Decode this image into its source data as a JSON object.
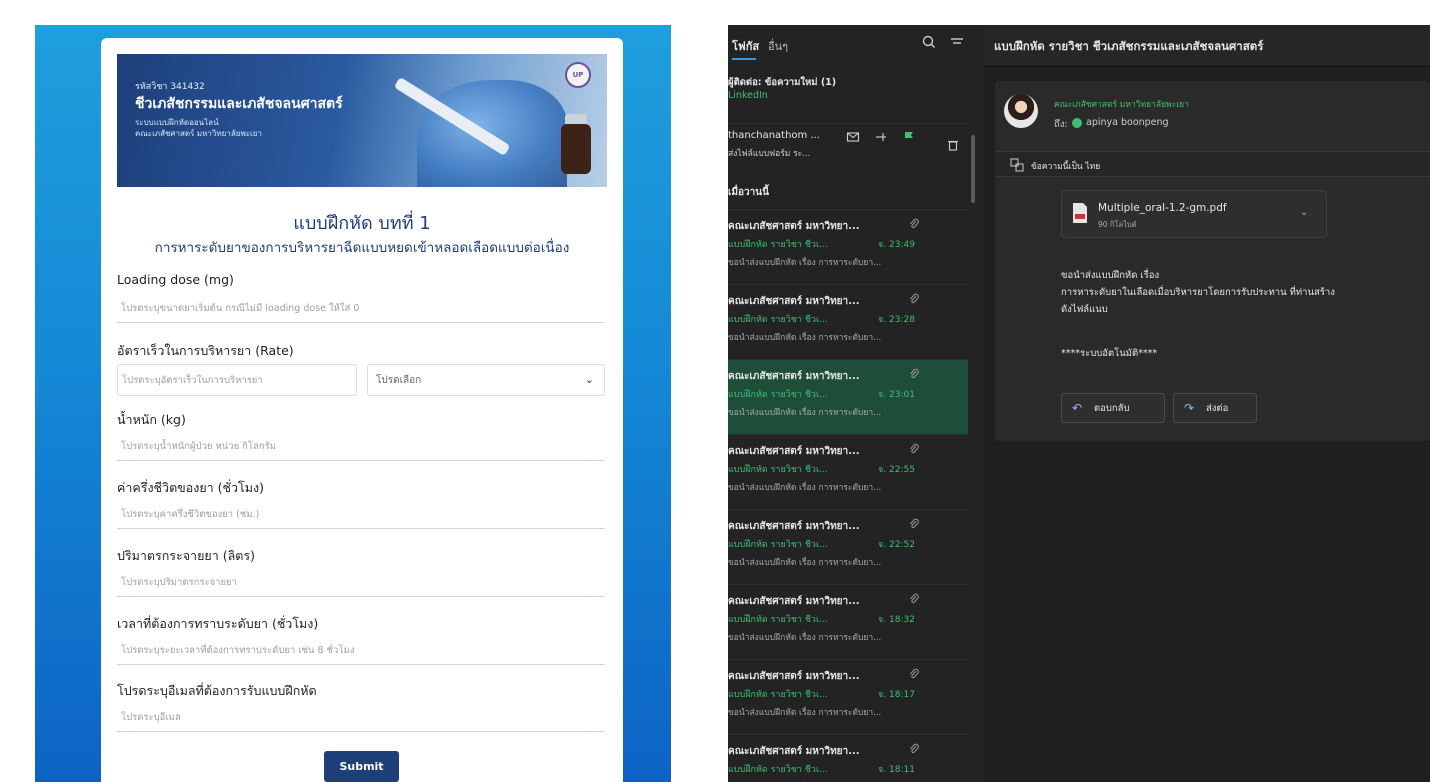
{
  "form": {
    "banner": {
      "course_code": "รหัสวิชา 341432",
      "course_title": "ชีวเภสัชกรรมและเภสัชจลนศาสตร์",
      "sub1": "ระบบแบบฝึกหัดออนไลน์",
      "sub2": "คณะเภสัชศาสตร์ มหาวิทยาลัยพะเยา",
      "logo_text": "UP"
    },
    "title": "แบบฝึกหัด บทที่ 1",
    "subtitle": "การหาระดับยาของการบริหารยาฉีดแบบหยดเข้าหลอดเลือดแบบต่อเนื่อง",
    "fields": [
      {
        "label": "Loading dose (mg)",
        "placeholder": "โปรดระบุขนาดยาเริ่มต้น กรณีไม่มี loading dose ให้ใส่ 0"
      },
      {
        "label": "อัตราเร็วในการบริหารยา (Rate)",
        "placeholder": "โปรดระบุอัตราเร็วในการบริหารยา",
        "select": "โปรดเลือก"
      },
      {
        "label": "น้ำหนัก (kg)",
        "placeholder": "โปรดระบุน้ำหนักผู้ป่วย หน่วย กิโลกรัม"
      },
      {
        "label": "ค่าครึ่งชีวิตของยา (ชั่วโมง)",
        "placeholder": "โปรดระบุค่าครึ่งชีวิตของยา (ชม.)"
      },
      {
        "label": "ปริมาตรกระจายยา (ลิตร)",
        "placeholder": "โปรดระบุปริมาตรกระจายยา"
      },
      {
        "label": "เวลาที่ต้องการทราบระดับยา (ชั่วโมง)",
        "placeholder": "โปรดระบุระยะเวลาที่ต้องการทราบระดับยา เช่น 8 ชั่วโมง"
      },
      {
        "label": "โปรดระบุอีเมลที่ต้องการรับแบบฝึกหัด",
        "placeholder": "โปรดระบุอีเมล"
      }
    ],
    "submit_label": "Submit"
  },
  "mail": {
    "tabs": {
      "focused": "โฟกัส",
      "other": "อื่นๆ"
    },
    "linkedin": {
      "sender": "ผู้ติดต่อ: ข้อความใหม่ (1)",
      "sub": "LinkedIn"
    },
    "pinned": {
      "sender": "thanchanathom ...",
      "sub": "ส่งไฟล์แบบฟอร์ม ระ..."
    },
    "section": "เมื่อวานนี้",
    "items": [
      {
        "sender": "คณะเภสัชศาสตร์ มหาวิทยา...",
        "subject": "แบบฝึกหัด รายวิชา ชีวเ...",
        "time": "จ. 23:49",
        "preview": "ขอนำส่งแบบฝึกหัด เรื่อง การหาระดับยา..."
      },
      {
        "sender": "คณะเภสัชศาสตร์ มหาวิทยา...",
        "subject": "แบบฝึกหัด รายวิชา ชีวเ...",
        "time": "จ. 23:28",
        "preview": "ขอนำส่งแบบฝึกหัด เรื่อง การหาระดับยา..."
      },
      {
        "sender": "คณะเภสัชศาสตร์ มหาวิทยา...",
        "subject": "แบบฝึกหัด รายวิชา ชีวเ...",
        "time": "จ. 23:01",
        "preview": "ขอนำส่งแบบฝึกหัด เรื่อง การหาระดับยา...",
        "selected": true
      },
      {
        "sender": "คณะเภสัชศาสตร์ มหาวิทยา...",
        "subject": "แบบฝึกหัด รายวิชา ชีวเ...",
        "time": "จ. 22:55",
        "preview": "ขอนำส่งแบบฝึกหัด เรื่อง การหาระดับยา..."
      },
      {
        "sender": "คณะเภสัชศาสตร์ มหาวิทยา...",
        "subject": "แบบฝึกหัด รายวิชา ชีวเ...",
        "time": "จ. 22:52",
        "preview": "ขอนำส่งแบบฝึกหัด เรื่อง การหาระดับยา..."
      },
      {
        "sender": "คณะเภสัชศาสตร์ มหาวิทยา...",
        "subject": "แบบฝึกหัด รายวิชา ชีวเ...",
        "time": "จ. 18:32",
        "preview": "ขอนำส่งแบบฝึกหัด เรื่อง การหาระดับยา..."
      },
      {
        "sender": "คณะเภสัชศาสตร์ มหาวิทยา...",
        "subject": "แบบฝึกหัด รายวิชา ชีวเ...",
        "time": "จ. 18:17",
        "preview": "ขอนำส่งแบบฝึกหัด เรื่อง การหาระดับยา..."
      },
      {
        "sender": "คณะเภสัชศาสตร์ มหาวิทยา...",
        "subject": "แบบฝึกหัด รายวิชา ชีวเ...",
        "time": "จ. 18:11",
        "preview": "ขอนำส่งแบบฝึกหัด เรื่อง การหาระดับยา..."
      }
    ],
    "reading": {
      "subject": "แบบฝึกหัด รายวิชา ชีวเภสัชกรรมและเภสัชจลนศาสตร์",
      "from": "คณะเภสัชศาสตร์ มหาวิทยาลัยพะเยา",
      "to_label": "ถึง:",
      "to_name": "apinya boonpeng",
      "translate": "ข้อความนี้เป็น ไทย",
      "attachment": {
        "name": "Multiple_oral-1.2-gm.pdf",
        "size": "90 กิโลไบต์"
      },
      "body1": "ขอนำส่งแบบฝึกหัด เรื่อง",
      "body2": "การหาระดับยาในเลือดเมื่อบริหารยาโดยการรับประทาน ที่ท่านสร้าง",
      "body3": "ดังไฟล์แนบ",
      "body4": "****ระบบอัตโนมัติ****",
      "reply_label": "ตอบกลับ",
      "forward_label": "ส่งต่อ"
    }
  },
  "colors": {
    "form_primary": "#1e3f77",
    "mail_green": "#3fbf76",
    "selected_row": "#1e4d3a",
    "gradient_top": "#1f9fdc",
    "gradient_bottom": "#0d63c4"
  }
}
